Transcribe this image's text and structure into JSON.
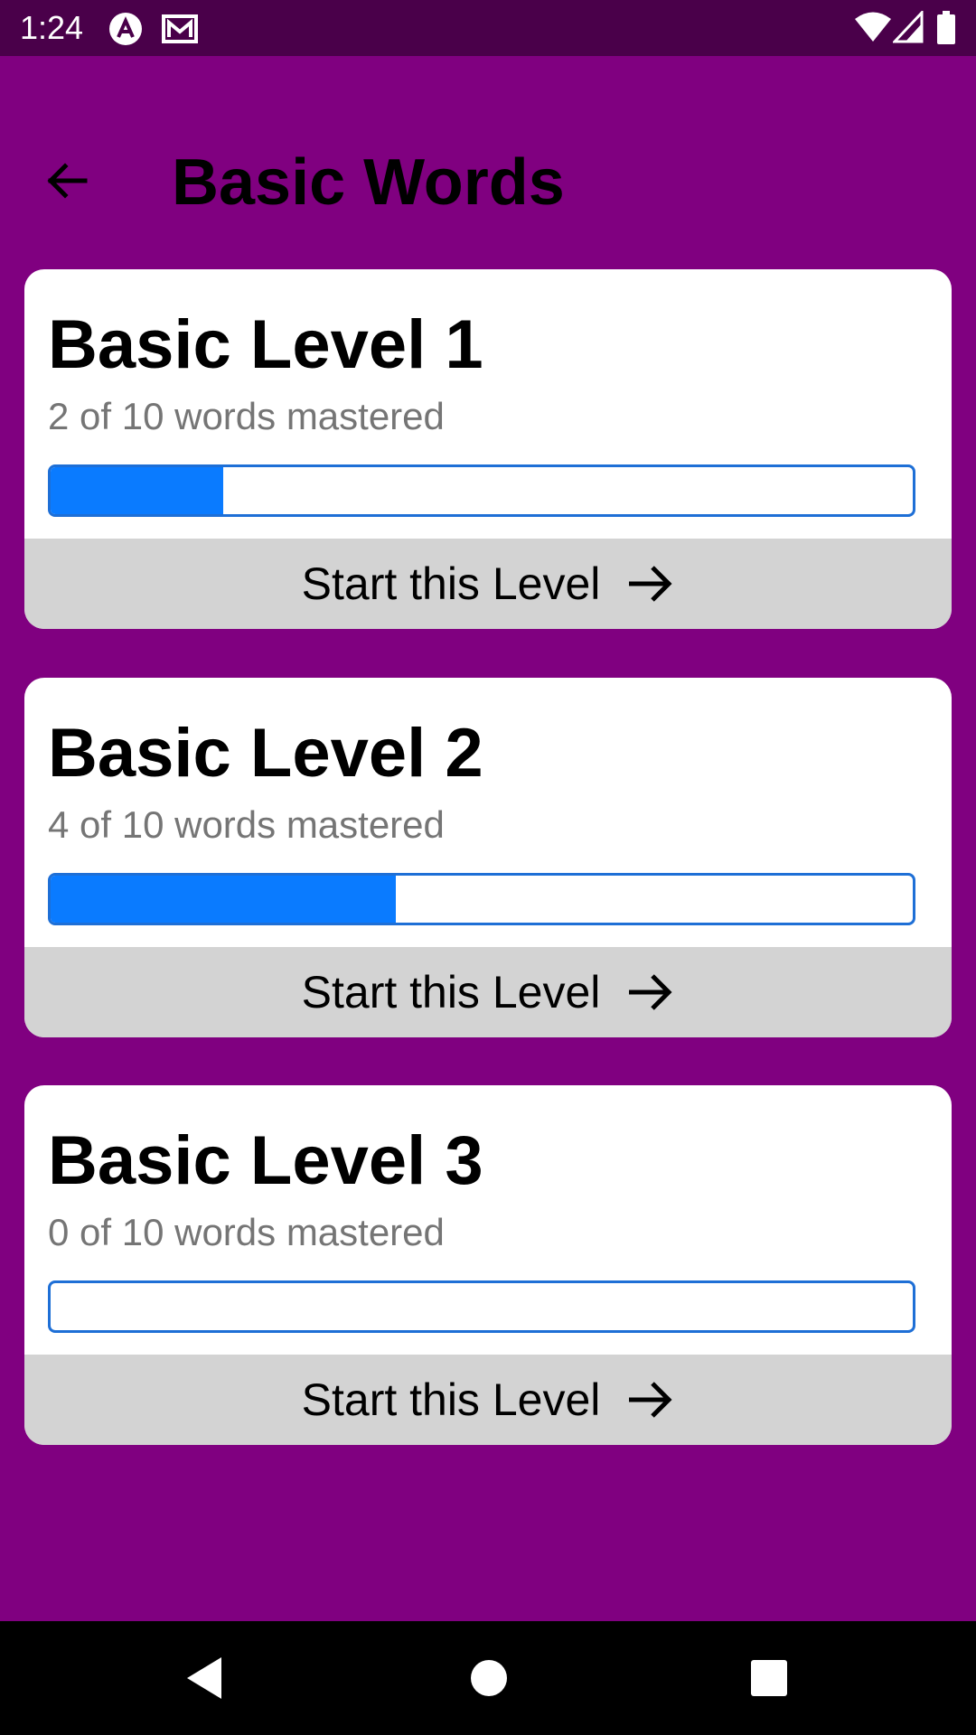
{
  "status_bar": {
    "time": "1:24",
    "left_icons": [
      "app-notification-icon",
      "mail-icon"
    ],
    "right_icons": [
      "wifi-icon",
      "cell-signal-icon",
      "battery-icon"
    ]
  },
  "header": {
    "title": "Basic Words",
    "back_icon": "arrow-back-icon"
  },
  "levels": [
    {
      "title": "Basic Level 1",
      "progress_text": "2 of 10 words mastered",
      "progress_fraction": 0.2,
      "button_label": "Start this Level"
    },
    {
      "title": "Basic Level 2",
      "progress_text": "4 of 10 words mastered",
      "progress_fraction": 0.4,
      "button_label": "Start this Level"
    },
    {
      "title": "Basic Level 3",
      "progress_text": "0 of 10 words mastered",
      "progress_fraction": 0.0,
      "button_label": "Start this Level"
    }
  ],
  "colors": {
    "background": "#800080",
    "status_bar": "#4a004a",
    "progress_fill": "#0a7bff",
    "progress_border": "#1e6fd6",
    "button_bg": "#d3d3d3"
  },
  "nav_bar": {
    "buttons": [
      "nav-back-icon",
      "nav-home-icon",
      "nav-recents-icon"
    ]
  }
}
